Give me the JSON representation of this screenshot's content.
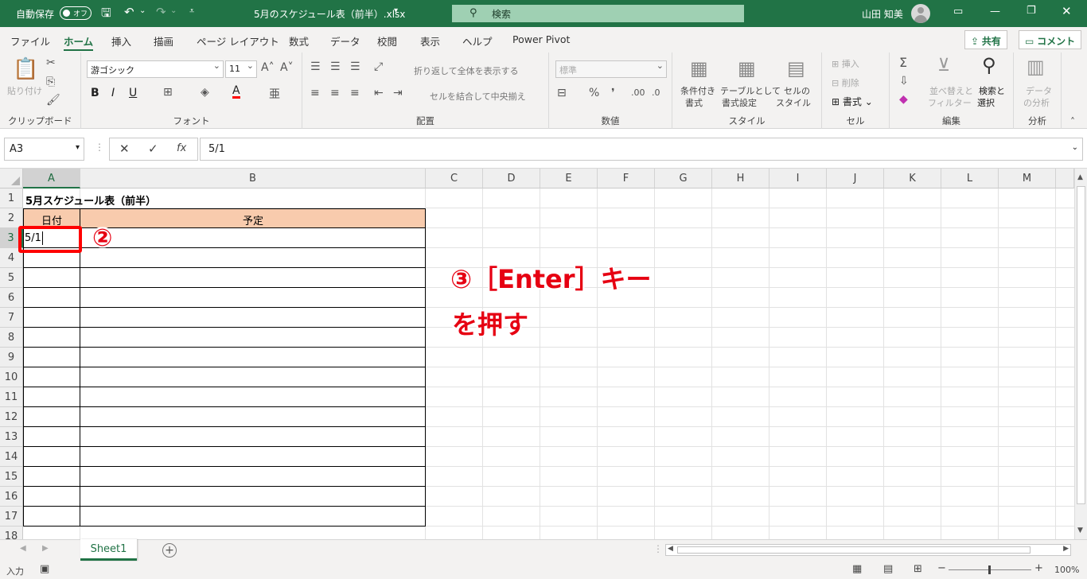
{
  "titlebar": {
    "autosave_label": "自動保存",
    "autosave_state": "オフ",
    "filename": "5月のスケジュール表（前半）.xlsx",
    "search_placeholder": "検索",
    "user_name": "山田 知美"
  },
  "menu": {
    "tabs": [
      "ファイル",
      "ホーム",
      "挿入",
      "描画",
      "ページ レイアウト",
      "数式",
      "データ",
      "校閲",
      "表示",
      "ヘルプ",
      "Power Pivot"
    ],
    "active": "ホーム",
    "share_label": "共有",
    "comment_label": "コメント"
  },
  "ribbon": {
    "clipboard": {
      "label": "クリップボード",
      "paste": "貼り付け"
    },
    "font": {
      "label": "フォント",
      "font_name": "游ゴシック",
      "font_size": "11"
    },
    "alignment": {
      "label": "配置",
      "wrap": "折り返して全体を表示する",
      "merge": "セルを結合して中央揃え"
    },
    "number": {
      "label": "数値",
      "format": "標準"
    },
    "styles": {
      "label": "スタイル",
      "cond1": "条件付き",
      "cond2": "書式",
      "table1": "テーブルとして",
      "table2": "書式設定",
      "cell1": "セルの",
      "cell2": "スタイル"
    },
    "cells": {
      "label": "セル",
      "insert": "挿入",
      "delete": "削除",
      "format": "書式"
    },
    "editing": {
      "label": "編集",
      "sort1": "並べ替えと",
      "sort2": "フィルター",
      "find1": "検索と",
      "find2": "選択"
    },
    "analysis": {
      "label": "分析",
      "data1": "データ",
      "data2": "の分析"
    }
  },
  "formula_bar": {
    "name_box": "A3",
    "value": "5/1"
  },
  "grid": {
    "columns": [
      "A",
      "B",
      "C",
      "D",
      "E",
      "F",
      "G",
      "H",
      "I",
      "J",
      "K",
      "L",
      "M"
    ],
    "rows": [
      "1",
      "2",
      "3",
      "4",
      "5",
      "6",
      "7",
      "8",
      "9",
      "10",
      "11",
      "12",
      "13",
      "14",
      "15",
      "16",
      "17",
      "18"
    ],
    "title": "5月スケジュール表（前半）",
    "header_date": "日付",
    "header_plan": "予定",
    "a3_value": "5/1",
    "header_fill": "#f8cbad"
  },
  "sheet_tabs": {
    "active": "Sheet1"
  },
  "status": {
    "mode": "入力",
    "zoom": "100%"
  },
  "annotations": {
    "step2": "②",
    "step3_line1": "③［Enter］キー",
    "step3_line2": "を押す",
    "color": "#e60012"
  }
}
